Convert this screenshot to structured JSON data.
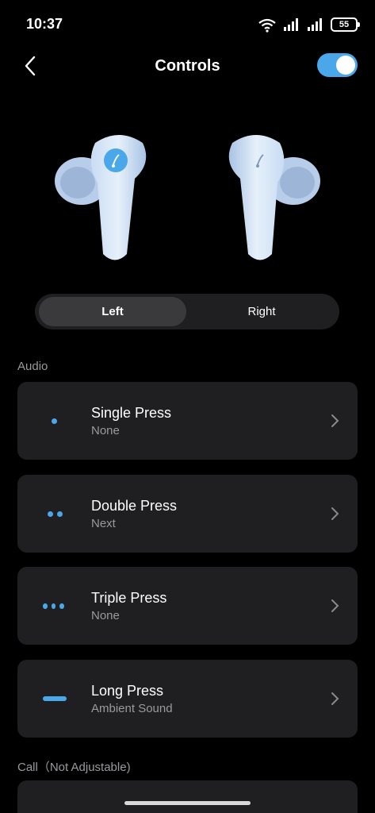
{
  "status_bar": {
    "time": "10:37",
    "battery": "55"
  },
  "header": {
    "title": "Controls",
    "toggle_on": true
  },
  "segment": {
    "left": "Left",
    "right": "Right",
    "selected": "Left"
  },
  "sections": {
    "audio": "Audio",
    "call": "Call（Not Adjustable)"
  },
  "controls": [
    {
      "title": "Single Press",
      "value": "None",
      "icon": "single-dot-icon"
    },
    {
      "title": "Double Press",
      "value": "Next",
      "icon": "double-dot-icon"
    },
    {
      "title": "Triple Press",
      "value": "None",
      "icon": "triple-dot-icon"
    },
    {
      "title": "Long Press",
      "value": "Ambient Sound",
      "icon": "long-press-icon"
    }
  ],
  "colors": {
    "accent": "#4aa8ea",
    "card": "#1f1f21",
    "background": "#000000"
  }
}
